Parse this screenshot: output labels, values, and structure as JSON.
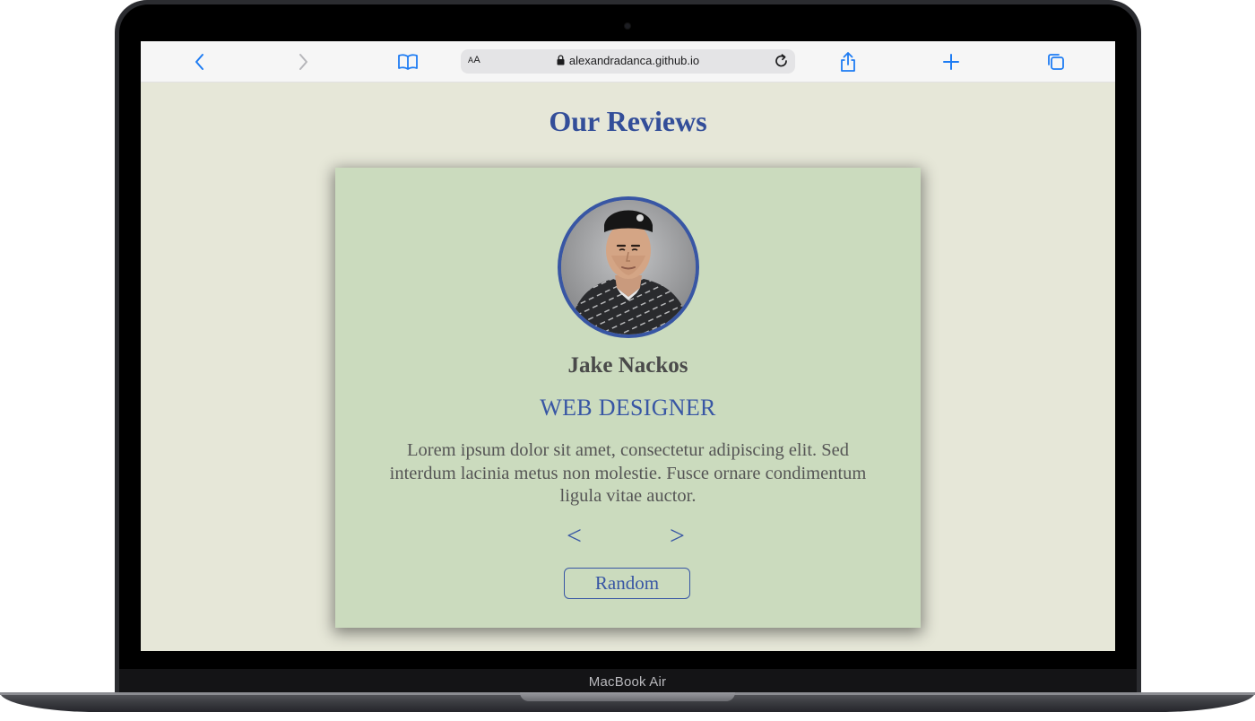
{
  "device": {
    "label": "MacBook Air"
  },
  "browser": {
    "url": "alexandradanca.github.io",
    "text_size_label_small": "A",
    "text_size_label_large": "A",
    "icons": [
      "chevron-left-icon",
      "chevron-right-icon",
      "book-icon",
      "lock-icon",
      "reload-icon",
      "share-icon",
      "plus-icon",
      "tabs-icon"
    ],
    "accent_color": "#1e7cf3"
  },
  "page": {
    "heading": "Our Reviews",
    "background_color": "#e6e7d8",
    "card_color": "#cbdbbe",
    "accent_color": "#3856a4",
    "review": {
      "name": "Jake Nackos",
      "role": "WEB DESIGNER",
      "text": "Lorem ipsum dolor sit amet, consectetur adipiscing elit. Sed interdum lacinia metus non molestie. Fusce ornare condimentum ligula vitae auctor."
    },
    "prev_label": "<",
    "next_label": ">",
    "random_label": "Random"
  }
}
